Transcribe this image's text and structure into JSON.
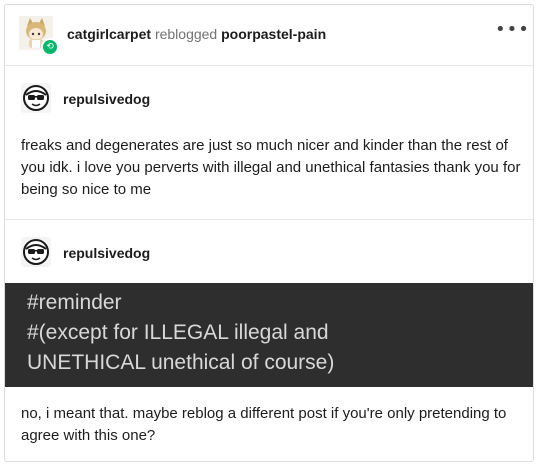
{
  "header": {
    "reblogger": "catgirlcarpet",
    "action": "reblogged",
    "source": "poorpastel-pain",
    "more_label": "•••"
  },
  "trail": [
    {
      "username": "repulsivedog",
      "text": "freaks and degenerates are just so much nicer and kinder than the rest of you idk. i love you perverts with illegal and unethical fantasies thank you for being so nice to me"
    },
    {
      "username": "repulsivedog",
      "tags": [
        "#reminder",
        "#(except for ILLEGAL illegal and",
        "UNETHICAL unethical of course)"
      ],
      "text": "no, i meant that. maybe reblog a different post if you're only pretending to agree with this one?"
    }
  ],
  "colors": {
    "reblog_badge": "#00b86b",
    "tag_background": "#2e2e2e",
    "divider": "#e6e6e6"
  },
  "icons": {
    "reblog": "reblog-icon",
    "more": "more-options-icon"
  }
}
